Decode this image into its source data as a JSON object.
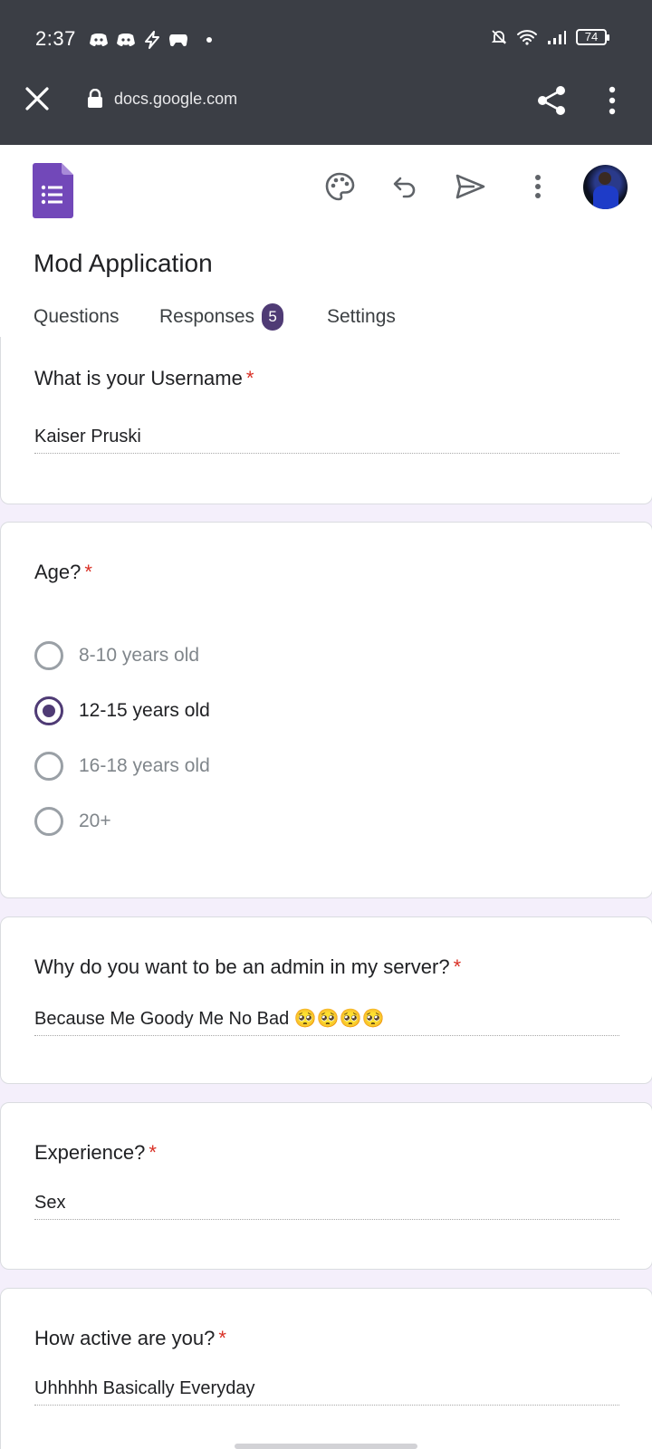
{
  "status_bar": {
    "time": "2:37",
    "battery": "74"
  },
  "browser": {
    "url": "docs.google.com"
  },
  "form": {
    "title": "Mod Application",
    "tabs": [
      {
        "label": "Questions"
      },
      {
        "label": "Responses",
        "badge": "5"
      },
      {
        "label": "Settings"
      }
    ],
    "active_tab": "Responses"
  },
  "questions": [
    {
      "title": "What is your Username",
      "required": "*",
      "answer": "Kaiser Pruski"
    },
    {
      "title": "Age?",
      "required": "*",
      "options": [
        "8-10 years old",
        "12-15 years old",
        "16-18 years old",
        "20+"
      ],
      "selected": "12-15 years old"
    },
    {
      "title": "Why do you want to be an admin in my server?",
      "required": "*",
      "answer": "Because Me Goody Me No Bad 🥺🥺🥺🥺"
    },
    {
      "title": "Experience?",
      "required": "*",
      "answer": "Sex"
    },
    {
      "title": "How active are you?",
      "required": "*",
      "answer": "Uhhhhh Basically Everyday"
    }
  ],
  "colors": {
    "accent": "#4f3b75",
    "required": "#d93025",
    "chrome": "#3b3e45",
    "background": "#f4effb"
  }
}
